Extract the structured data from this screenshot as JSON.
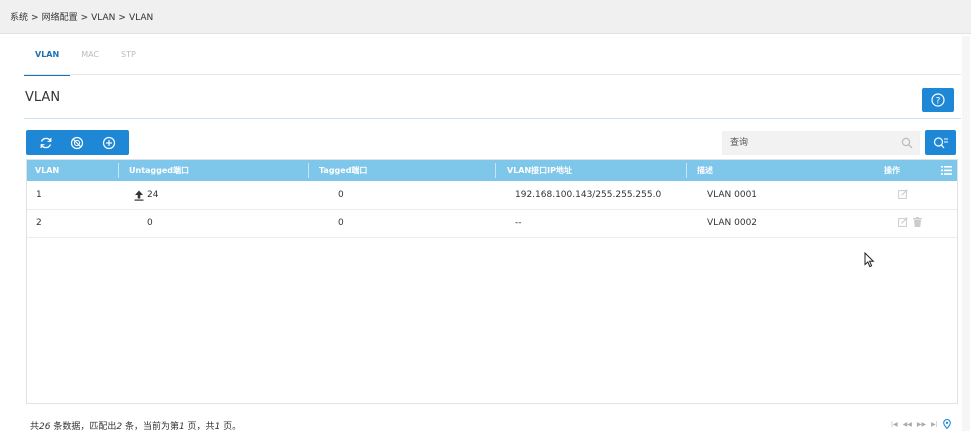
{
  "breadcrumb": {
    "items": [
      "系统",
      "网络配置",
      "VLAN",
      "VLAN"
    ]
  },
  "tabs": [
    {
      "label": "VLAN",
      "active": true
    },
    {
      "label": "MAC",
      "active": false
    },
    {
      "label": "STP",
      "active": false
    }
  ],
  "page": {
    "title": "VLAN"
  },
  "toolbar": {
    "icons": [
      "refresh-icon",
      "disable-icon",
      "add-icon"
    ]
  },
  "search": {
    "placeholder": "查询",
    "value": ""
  },
  "table": {
    "columns": [
      "VLAN",
      "Untagged端口",
      "Tagged端口",
      "VLAN接口IP地址",
      "描述",
      "操作"
    ],
    "rows": [
      {
        "vlan": "1",
        "untagged": "24",
        "untagged_icon": "upload-icon",
        "tagged": "0",
        "ip": "192.168.100.143/255.255.255.0",
        "desc": "VLAN 0001",
        "actions": [
          "edit-icon"
        ]
      },
      {
        "vlan": "2",
        "untagged": "0",
        "untagged_icon": "",
        "tagged": "0",
        "ip": "--",
        "desc": "VLAN 0002",
        "actions": [
          "edit-icon",
          "delete-icon"
        ]
      }
    ]
  },
  "footer": {
    "p1": "共",
    "total": "26",
    "p2": " 条数据，匹配出",
    "matched": "2",
    "p3": " 条，当前为第",
    "page": "1",
    "p4": " 页，共",
    "pages": "1",
    "p5": " 页。"
  },
  "colors": {
    "accent": "#1e88d6",
    "header": "#7ec6ea"
  }
}
